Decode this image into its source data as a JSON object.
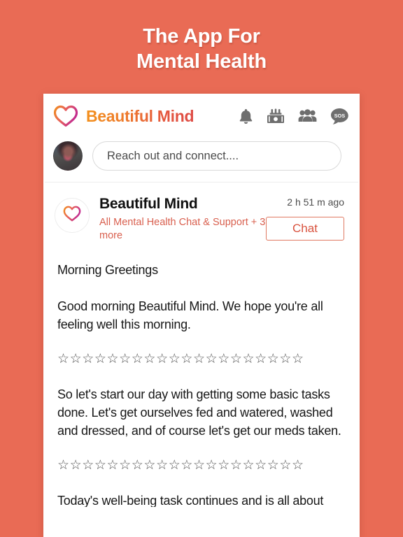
{
  "promo": {
    "line1": "The App For",
    "line2": "Mental Health",
    "background_color": "#E96B55",
    "text_color": "#FFFFFF"
  },
  "appbar": {
    "brand": "Beautiful Mind",
    "logo_icon": "heart-gradient-icon",
    "icons": [
      {
        "name": "bell-icon",
        "label": "Notifications"
      },
      {
        "name": "donate-money-icon",
        "label": "Donate"
      },
      {
        "name": "groups-people-icon",
        "label": "Groups"
      },
      {
        "name": "sos-chat-icon",
        "label": "SOS"
      }
    ]
  },
  "composer": {
    "avatar": "user-avatar",
    "placeholder": "Reach out and connect....",
    "value": "Reach out and connect...."
  },
  "post": {
    "avatar_icon": "heart-gradient-icon",
    "author": "Beautiful Mind",
    "groups": "All Mental Health Chat & Support + 3 more",
    "timestamp": "2 h 51 m ago",
    "chat_label": "Chat",
    "accent_color": "#D9533F",
    "groups_color": "#D9604F",
    "title": "Morning Greetings",
    "paragraph_1": "Good morning Beautiful Mind. We hope you're all feeling well this morning.",
    "divider_1": "☆☆☆☆☆☆☆☆☆☆☆☆☆☆☆☆☆☆☆☆",
    "paragraph_2": "So let's start our day with getting some basic tasks done. Let's get ourselves fed and watered, washed and dressed, and of course let's get our meds taken.",
    "divider_2": "☆☆☆☆☆☆☆☆☆☆☆☆☆☆☆☆☆☆☆☆",
    "paragraph_3": "Today's well-being task continues and is all about"
  }
}
